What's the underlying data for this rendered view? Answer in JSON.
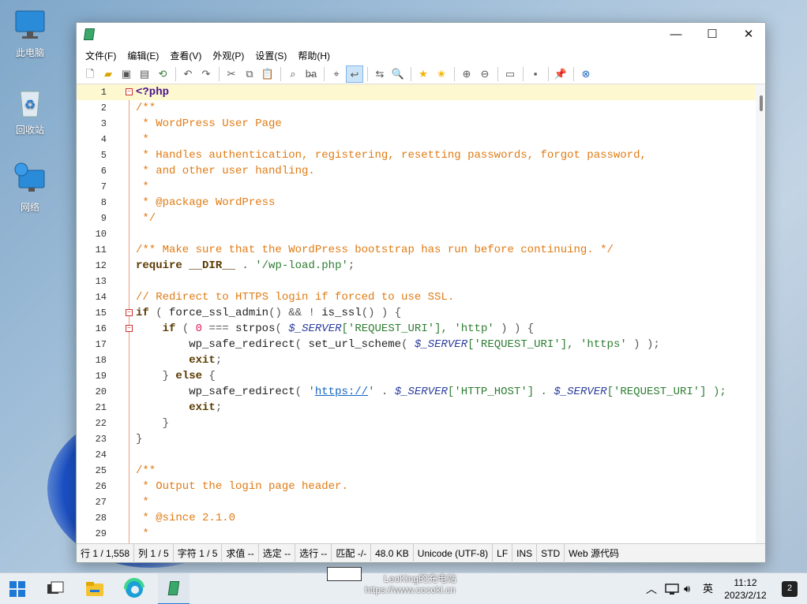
{
  "desktop": {
    "icons": [
      {
        "label": "此电脑"
      },
      {
        "label": "回收站"
      },
      {
        "label": "网络"
      }
    ]
  },
  "window": {
    "menu": [
      "文件(F)",
      "编辑(E)",
      "查看(V)",
      "外观(P)",
      "设置(S)",
      "帮助(H)"
    ],
    "controls": {
      "minimize": "—",
      "maximize": "☐",
      "close": "✕"
    }
  },
  "editor": {
    "lines": [
      "1",
      "2",
      "3",
      "4",
      "5",
      "6",
      "7",
      "8",
      "9",
      "10",
      "11",
      "12",
      "13",
      "14",
      "15",
      "16",
      "17",
      "18",
      "19",
      "20",
      "21",
      "22",
      "23",
      "24",
      "25",
      "26",
      "27",
      "28",
      "29"
    ]
  },
  "code": {
    "l1": "<?php",
    "l2": "/**",
    "l3": " * WordPress User Page",
    "l4": " *",
    "l5": " * Handles authentication, registering, resetting passwords, forgot password,",
    "l6": " * and other user handling.",
    "l7": " *",
    "l8": " * @package WordPress",
    "l9": " */",
    "l11": "/** Make sure that the WordPress bootstrap has run before continuing. */",
    "l12a": "require __DIR__",
    "l12b": " . ",
    "l12c": "'/wp-load.php'",
    "l12d": ";",
    "l14": "// Redirect to HTTPS login if forced to use SSL.",
    "l15a": "if",
    "l15b": " ( ",
    "l15c": "force_ssl_admin",
    "l15d": "() && ! ",
    "l15e": "is_ssl",
    "l15f": "() ) {",
    "l16a": "    if",
    "l16b": " ( ",
    "l16c": "0",
    "l16d": " === ",
    "l16e": "strpos",
    "l16f": "( ",
    "l16g": "$_SERVER",
    "l16h": "['REQUEST_URI'], ",
    "l16i": "'http'",
    "l16j": " ) ) {",
    "l17a": "        wp_safe_redirect",
    "l17b": "( ",
    "l17c": "set_url_scheme",
    "l17d": "( ",
    "l17e": "$_SERVER",
    "l17f": "['REQUEST_URI'], ",
    "l17g": "'https'",
    "l17h": " ) );",
    "l18a": "        exit",
    "l18b": ";",
    "l19a": "    } ",
    "l19b": "else",
    "l19c": " {",
    "l20a": "        wp_safe_redirect",
    "l20b": "( ",
    "l20c": "'",
    "l20d": "https://",
    "l20e": "'",
    "l20f": " . ",
    "l20g": "$_SERVER",
    "l20h": "['HTTP_HOST'] . ",
    "l20i": "$_SERVER",
    "l20j": "['REQUEST_URI'] );",
    "l21a": "        exit",
    "l21b": ";",
    "l22": "    }",
    "l23": "}",
    "l25": "/**",
    "l26": " * Output the login page header.",
    "l27": " *",
    "l28": " * @since 2.1.0",
    "l29": " *"
  },
  "status": [
    "行  1 / 1,558",
    "列  1 / 5",
    "字符  1 / 5",
    "求值  --",
    "选定  --",
    "选行  --",
    "匹配  -/-",
    "48.0 KB",
    "Unicode (UTF-8)",
    "LF",
    "INS",
    "STD",
    "Web 源代码"
  ],
  "watermark": {
    "line1": "LeoKing的充电站",
    "line2": "https://www.cocokl.cn"
  },
  "taskbar": {
    "lang": "英",
    "time": "11:12",
    "date": "2023/2/12",
    "badge": "2"
  }
}
